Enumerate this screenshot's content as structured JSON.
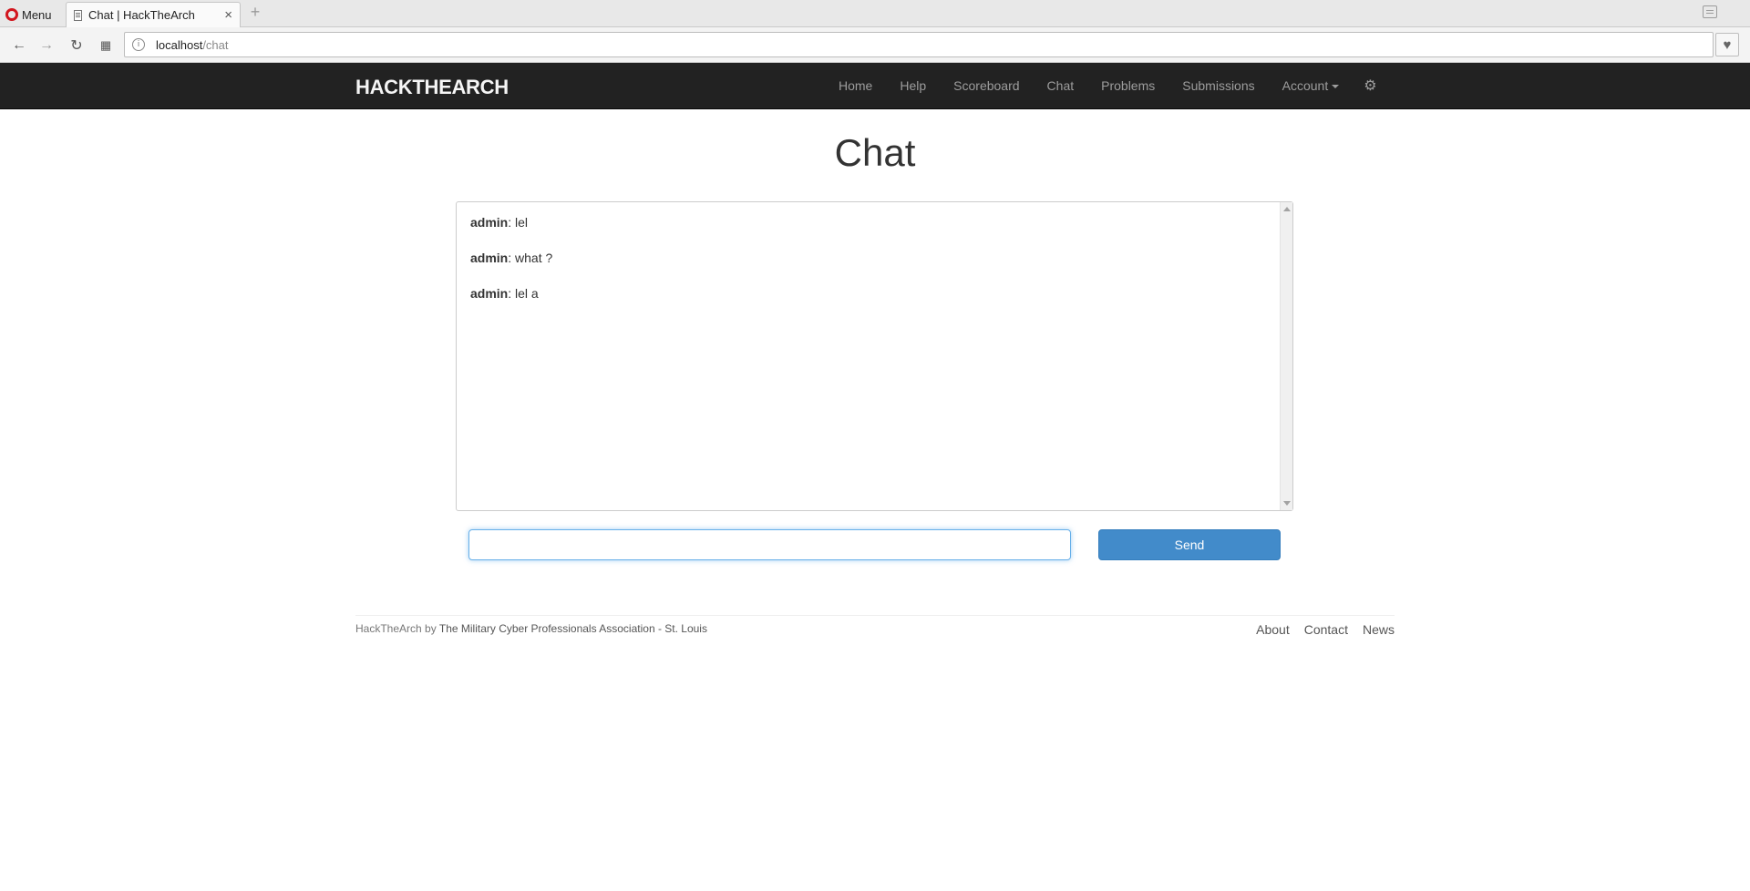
{
  "browser": {
    "menu_label": "Menu",
    "tab_title": "Chat | HackTheArch",
    "tab_close": "×",
    "new_tab": "+",
    "url_host": "localhost",
    "url_path": "/chat"
  },
  "nav": {
    "brand": "HACKTHEARCH",
    "links": [
      "Home",
      "Help",
      "Scoreboard",
      "Chat",
      "Problems",
      "Submissions",
      "Account"
    ]
  },
  "page": {
    "title": "Chat"
  },
  "chat": {
    "messages": [
      {
        "user": "admin",
        "text": ": lel"
      },
      {
        "user": "admin",
        "text": ": what ?"
      },
      {
        "user": "admin",
        "text": ": lel a"
      }
    ],
    "input_value": "",
    "send_label": "Send"
  },
  "footer": {
    "site": "HackTheArch",
    "by": "by",
    "org": "The Military Cyber Professionals Association - St. Louis",
    "links": [
      "About",
      "Contact",
      "News"
    ]
  },
  "colors": {
    "navbar_bg": "#222222",
    "send_button": "#428bca",
    "input_focus": "#66afe9"
  }
}
